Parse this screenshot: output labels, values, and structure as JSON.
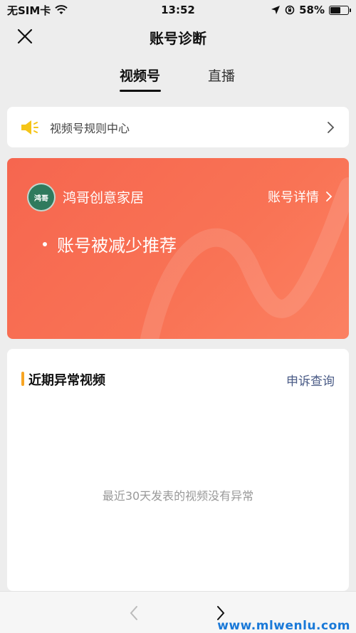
{
  "status_bar": {
    "carrier": "无SIM卡",
    "time": "13:52",
    "battery": "58%",
    "battery_level": 0.58
  },
  "nav": {
    "title": "账号诊断"
  },
  "tabs": [
    {
      "label": "视频号",
      "active": true
    },
    {
      "label": "直播",
      "active": false
    }
  ],
  "rules": {
    "label": "视频号规则中心"
  },
  "account": {
    "avatar_text": "鸿哥",
    "name": "鸿哥创意家居",
    "detail_label": "账号详情",
    "notice": "账号被减少推荐"
  },
  "abnormal": {
    "title": "近期异常视频",
    "appeal_label": "申诉查询",
    "empty_text": "最近30天发表的视频没有异常"
  },
  "watermark": "www.mlwenlu.com",
  "colors": {
    "card_gradient_start": "#f6664f",
    "card_gradient_end": "#fb8162",
    "accent_bar": "#f7a523",
    "link": "#4a5b86",
    "speaker": "#f5c518"
  }
}
